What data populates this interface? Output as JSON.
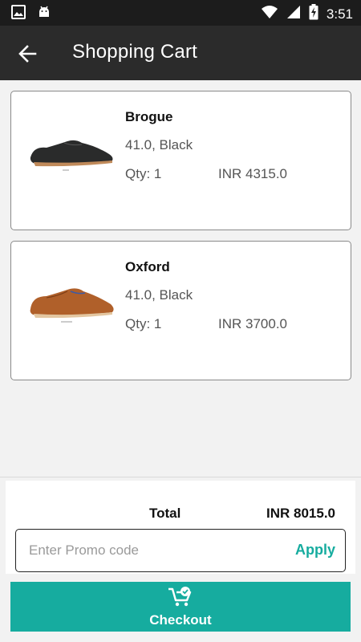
{
  "status_bar": {
    "time": "3:51",
    "icons": [
      "image-icon",
      "android-icon",
      "wifi-icon",
      "signal-icon",
      "battery-charging-icon"
    ]
  },
  "header": {
    "title": "Shopping Cart",
    "back_icon": "arrow-left-icon"
  },
  "cart": {
    "items": [
      {
        "name": "Brogue",
        "variant": "41.0, Black",
        "qty": "Qty: 1",
        "price": "INR 4315.0",
        "shoe_color": "#2a2b2b"
      },
      {
        "name": "Oxford",
        "variant": "41.0, Black",
        "qty": "Qty: 1",
        "price": "INR 3700.0",
        "shoe_color": "#b0602a"
      }
    ]
  },
  "summary": {
    "total_label": "Total",
    "total_value": "INR 8015.0"
  },
  "promo": {
    "placeholder": "Enter Promo code",
    "apply_label": "Apply"
  },
  "checkout": {
    "label": "Checkout",
    "icon": "cart-check-icon"
  },
  "colors": {
    "accent": "#16ac9f",
    "app_bar": "#2b2b2b",
    "status_bar": "#1c1c1c"
  }
}
